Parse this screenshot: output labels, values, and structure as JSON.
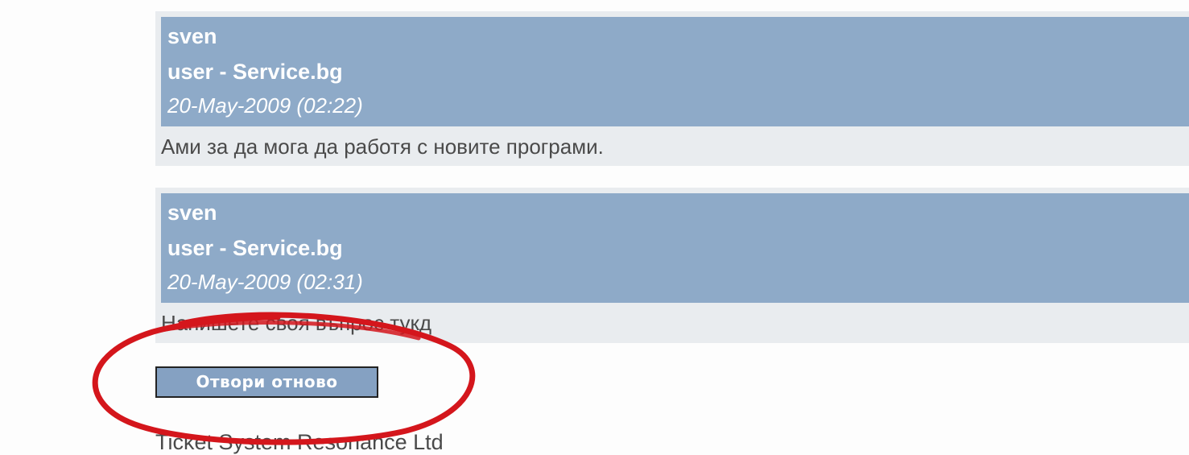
{
  "messages": [
    {
      "author": "sven",
      "role": "user - Service.bg",
      "date": "20-May-2009 (02:22)",
      "body": "Ами за да мога да работя с новите програми."
    },
    {
      "author": "sven",
      "role": "user - Service.bg",
      "date": "20-May-2009 (02:31)",
      "body": "Напишете своя въпрос тукд"
    }
  ],
  "actions": {
    "reopen_label": "Отвори отново"
  },
  "footer": {
    "text": "Ticket System Resonance Ltd"
  },
  "colors": {
    "header_bg": "#8eaac8",
    "body_bg": "#e9ecef",
    "button_bg": "#85a1c2",
    "annotation_red": "#d4161c"
  },
  "icons": {
    "annotation": "red-ellipse-highlight"
  }
}
